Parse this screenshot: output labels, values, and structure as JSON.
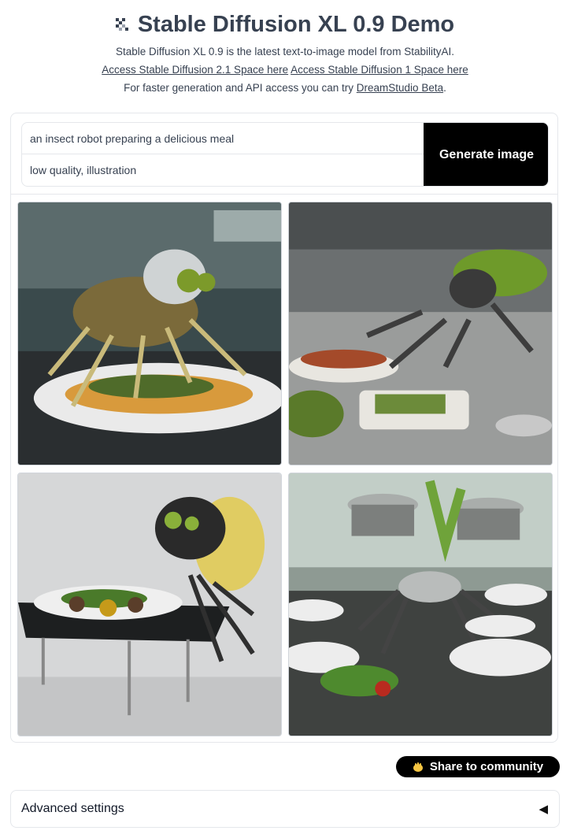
{
  "header": {
    "title": "Stable Diffusion XL 0.9 Demo",
    "description": "Stable Diffusion XL 0.9 is the latest text-to-image model from StabilityAI.",
    "link_sd21": "Access Stable Diffusion 2.1 Space here",
    "link_sd1": "Access Stable Diffusion 1 Space here",
    "faster_prefix": "For faster generation and API access you can try ",
    "dreamstudio_link": "DreamStudio Beta",
    "faster_suffix": "."
  },
  "prompt": {
    "value": "an insect robot preparing a delicious meal",
    "negative_value": "low quality, illustration",
    "generate_label": "Generate image"
  },
  "gallery": {
    "count": 4
  },
  "share": {
    "label": "Share to community",
    "icon": "hands-icon"
  },
  "advanced": {
    "label": "Advanced settings",
    "toggle_glyph": "◀"
  },
  "colors": {
    "button_bg": "#000000",
    "border": "#e5e7eb",
    "text": "#374151"
  }
}
